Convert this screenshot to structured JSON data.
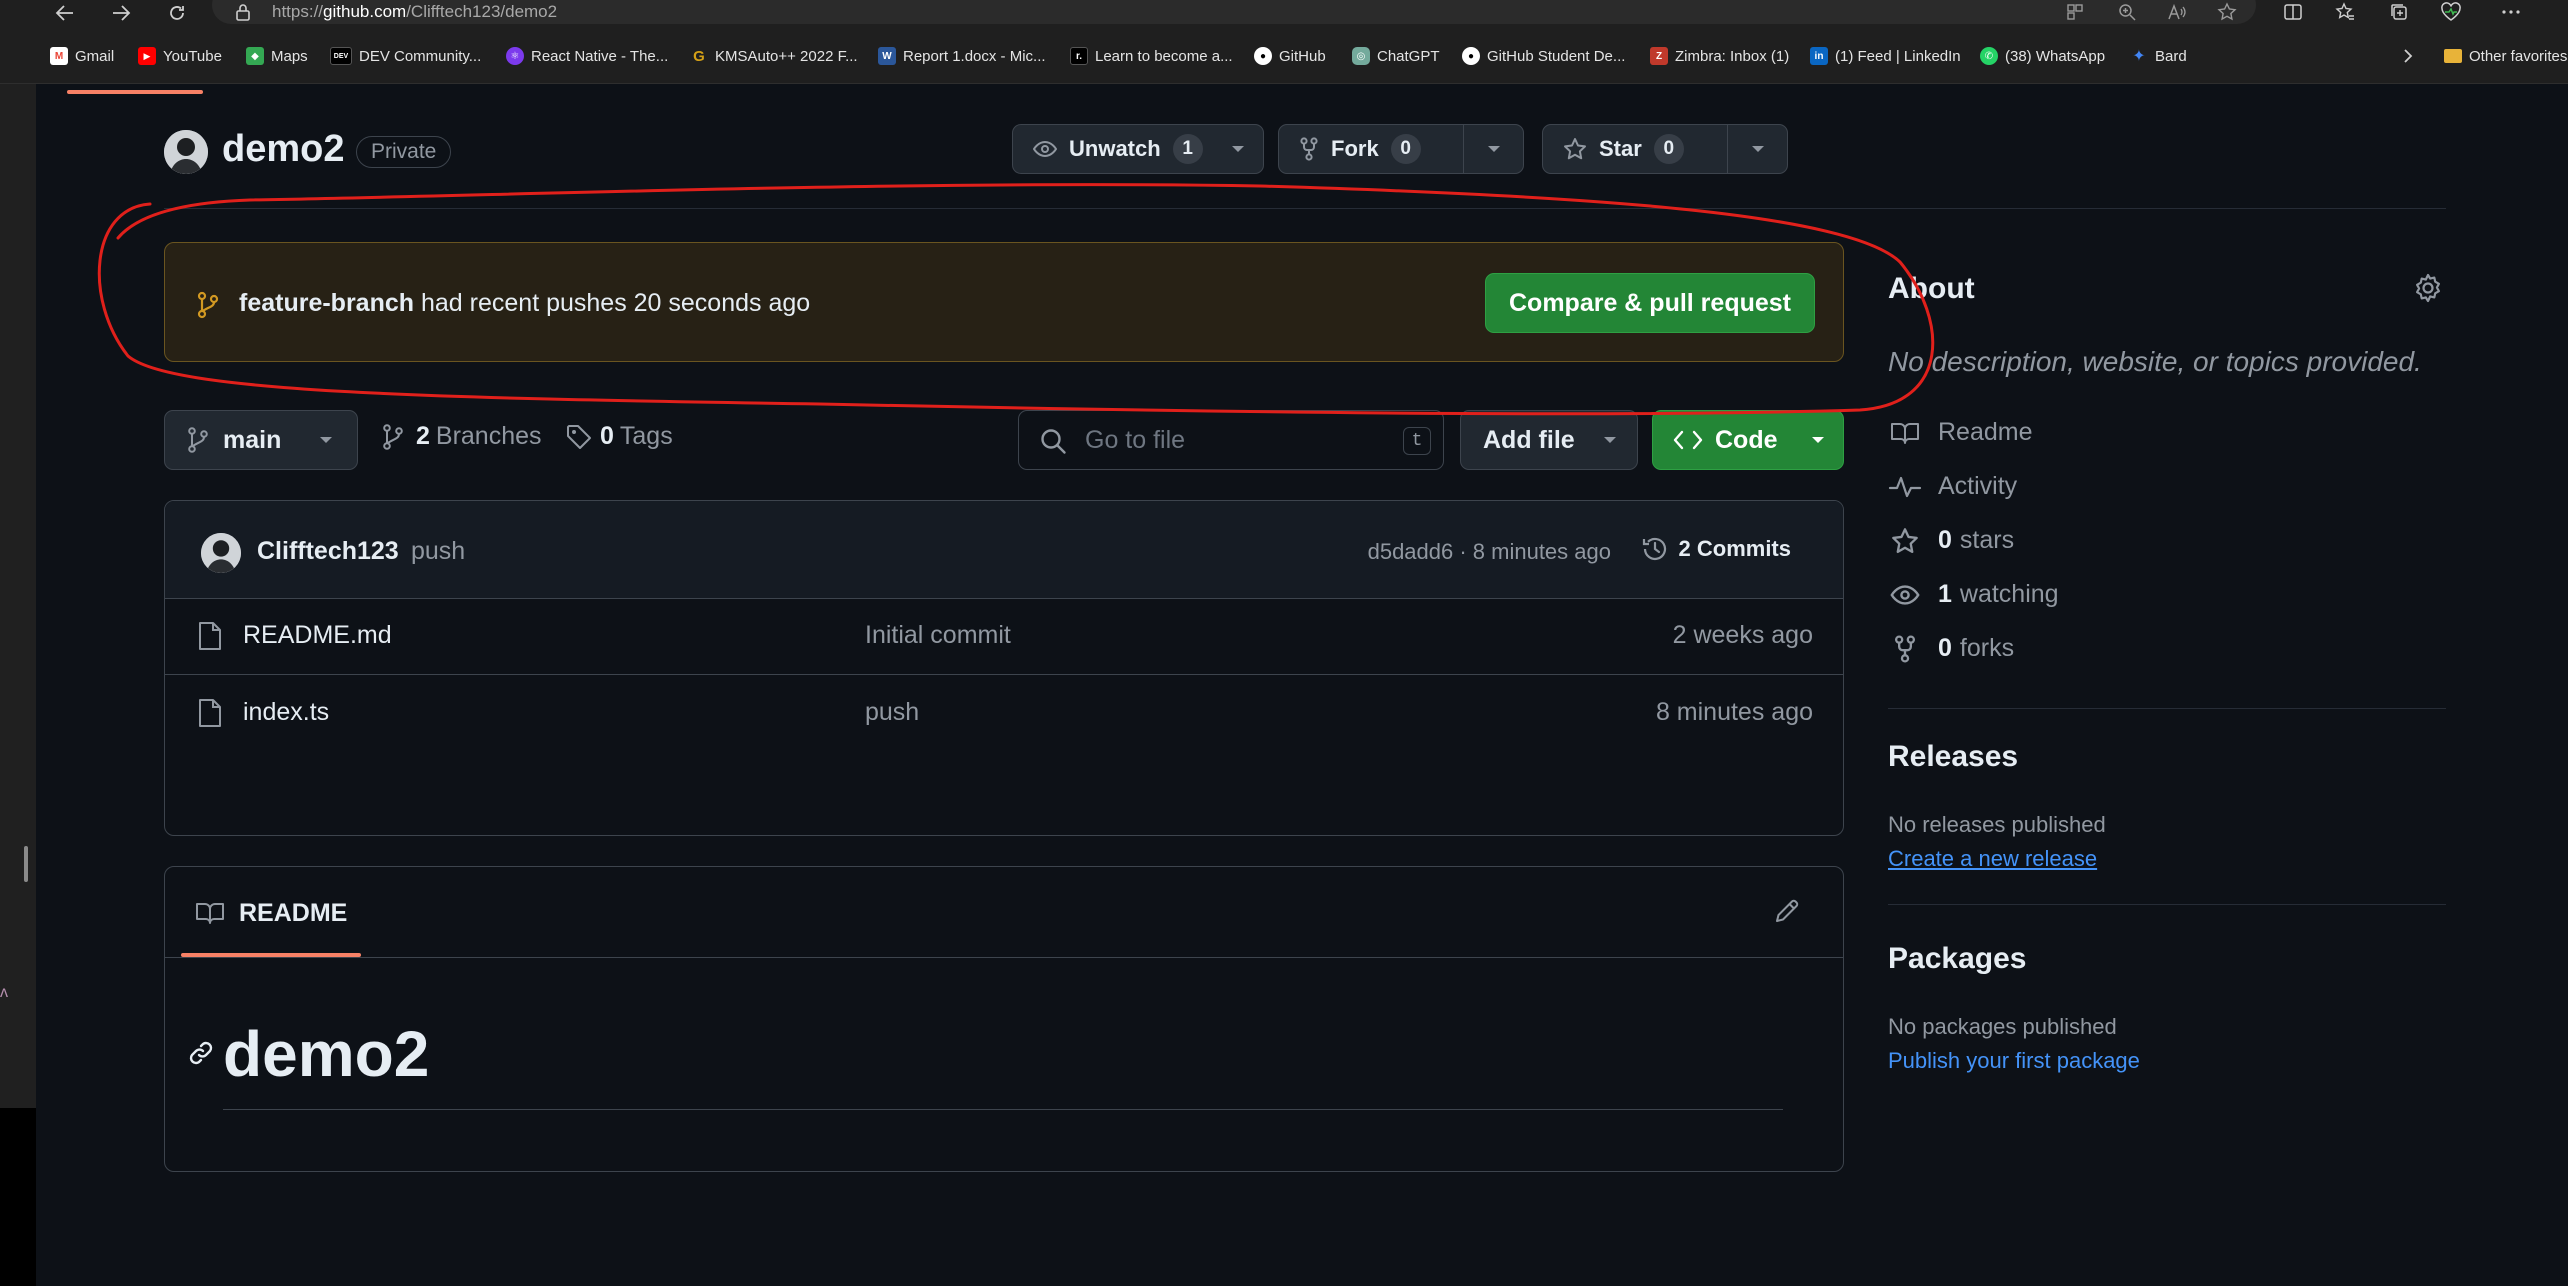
{
  "browser": {
    "url_prefix": "https://",
    "url_host": "github.com",
    "url_path": "/Clifftech123/demo2",
    "bookmarks": [
      {
        "label": "Gmail",
        "icon": "gmail-icon",
        "color": "#ea4335",
        "glyph": "M"
      },
      {
        "label": "YouTube",
        "icon": "youtube-icon",
        "color": "#ff0000",
        "glyph": "▶"
      },
      {
        "label": "Maps",
        "icon": "maps-icon",
        "color": "#34a853",
        "glyph": "◆"
      },
      {
        "label": "DEV Community...",
        "icon": "dev-icon",
        "color": "#000000",
        "glyph": "DEV"
      },
      {
        "label": "React Native - The...",
        "icon": "react-native-icon",
        "color": "#7c3aed",
        "glyph": "⚛"
      },
      {
        "label": "KMSAuto++ 2022 F...",
        "icon": "kmsauto-icon",
        "color": "#d4a017",
        "glyph": "G"
      },
      {
        "label": "Report 1.docx - Mic...",
        "icon": "word-icon",
        "color": "#2b579a",
        "glyph": "W"
      },
      {
        "label": "Learn to become a...",
        "icon": "roadmap-icon",
        "color": "#000000",
        "glyph": "r."
      },
      {
        "label": "GitHub",
        "icon": "github-icon",
        "color": "#ffffff",
        "glyph": "●"
      },
      {
        "label": "ChatGPT",
        "icon": "chatgpt-icon",
        "color": "#74aa9c",
        "glyph": "◎"
      },
      {
        "label": "GitHub Student De...",
        "icon": "github-student-icon",
        "color": "#ffffff",
        "glyph": "●"
      },
      {
        "label": "Zimbra: Inbox (1)",
        "icon": "zimbra-icon",
        "color": "#c0392b",
        "glyph": "Z"
      },
      {
        "label": "(1) Feed | LinkedIn",
        "icon": "linkedin-icon",
        "color": "#0a66c2",
        "glyph": "in"
      },
      {
        "label": "(38) WhatsApp",
        "icon": "whatsapp-icon",
        "color": "#25d366",
        "glyph": "✆"
      },
      {
        "label": "Bard",
        "icon": "bard-icon",
        "color": "#4285f4",
        "glyph": "✦"
      }
    ],
    "other_favorites": "Other favorites"
  },
  "repo": {
    "name": "demo2",
    "visibility": "Private",
    "unwatch_label": "Unwatch",
    "unwatch_count": "1",
    "fork_label": "Fork",
    "fork_count": "0",
    "star_label": "Star",
    "star_count": "0"
  },
  "banner": {
    "branch": "feature-branch",
    "message": "had recent pushes 20 seconds ago",
    "button": "Compare & pull request"
  },
  "toolbar": {
    "branch": "main",
    "branches_count": "2",
    "branches_label": "Branches",
    "tags_count": "0",
    "tags_label": "Tags",
    "search_placeholder": "Go to file",
    "search_shortcut": "t",
    "add_file": "Add file",
    "code": "Code"
  },
  "latest_commit": {
    "author": "Clifftech123",
    "message": "push",
    "hash_time": "d5dadd6 · 8 minutes ago",
    "commits_label": "2 Commits"
  },
  "files": [
    {
      "name": "README.md",
      "message": "Initial commit",
      "age": "2 weeks ago"
    },
    {
      "name": "index.ts",
      "message": "push",
      "age": "8 minutes ago"
    }
  ],
  "readme": {
    "tab_label": "README",
    "heading": "demo2"
  },
  "sidebar": {
    "about_title": "About",
    "about_desc": "No description, website, or topics provided.",
    "readme_label": "Readme",
    "activity_label": "Activity",
    "stars_count": "0",
    "stars_label": "stars",
    "watching_count": "1",
    "watching_label": "watching",
    "forks_count": "0",
    "forks_label": "forks",
    "releases_title": "Releases",
    "releases_empty": "No releases published",
    "releases_link": "Create a new release",
    "packages_title": "Packages",
    "packages_empty": "No packages published",
    "packages_link": "Publish your first package"
  },
  "colors": {
    "page_bg": "#0d1117",
    "accent_green": "#238636",
    "link_blue": "#4493f8",
    "banner_bg": "#272115",
    "annotation_red": "#e0201b"
  }
}
